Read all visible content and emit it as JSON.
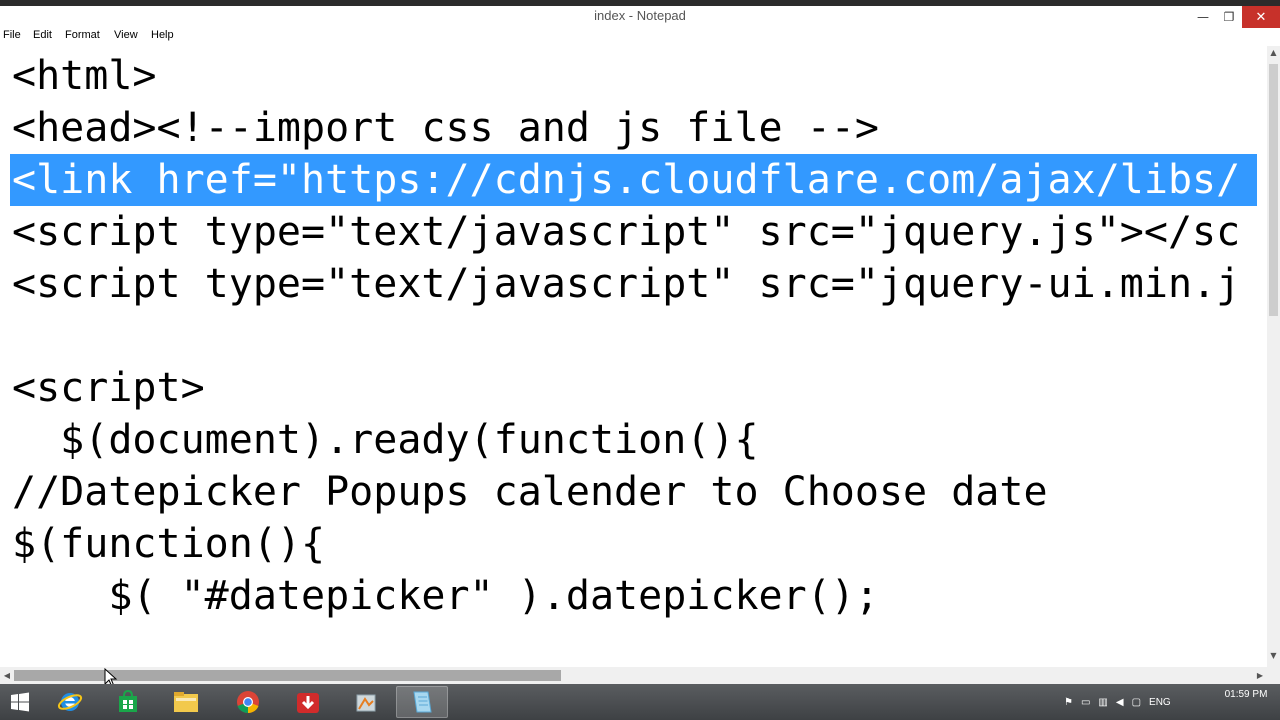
{
  "window": {
    "title": "index - Notepad",
    "minimize_glyph": "—",
    "maximize_glyph": "❐",
    "close_glyph": "✕"
  },
  "menu": [
    "File",
    "Edit",
    "Format",
    "View",
    "Help"
  ],
  "editor": {
    "lines": [
      "<html>",
      "<head><!--import css and js file -->",
      "<link href=\"https://cdnjs.cloudflare.com/ajax/libs/",
      "<script type=\"text/javascript\" src=\"jquery.js\"></sc",
      "<script type=\"text/javascript\" src=\"jquery-ui.min.j",
      "",
      "<script>",
      "  $(document).ready(function(){",
      "//Datepicker Popups calender to Choose date",
      "$(function(){",
      "    $( \"#datepicker\" ).datepicker();"
    ],
    "selected_line_index": 2,
    "selection_color": "#3399ff"
  },
  "taskbar": {
    "apps": [
      "start-button",
      "internet-explorer-icon",
      "store-icon",
      "file-explorer-icon",
      "chrome-icon",
      "downloader-icon",
      "paint-icon",
      "notepad-icon"
    ],
    "language": "ENG",
    "time": "01:59 PM"
  }
}
